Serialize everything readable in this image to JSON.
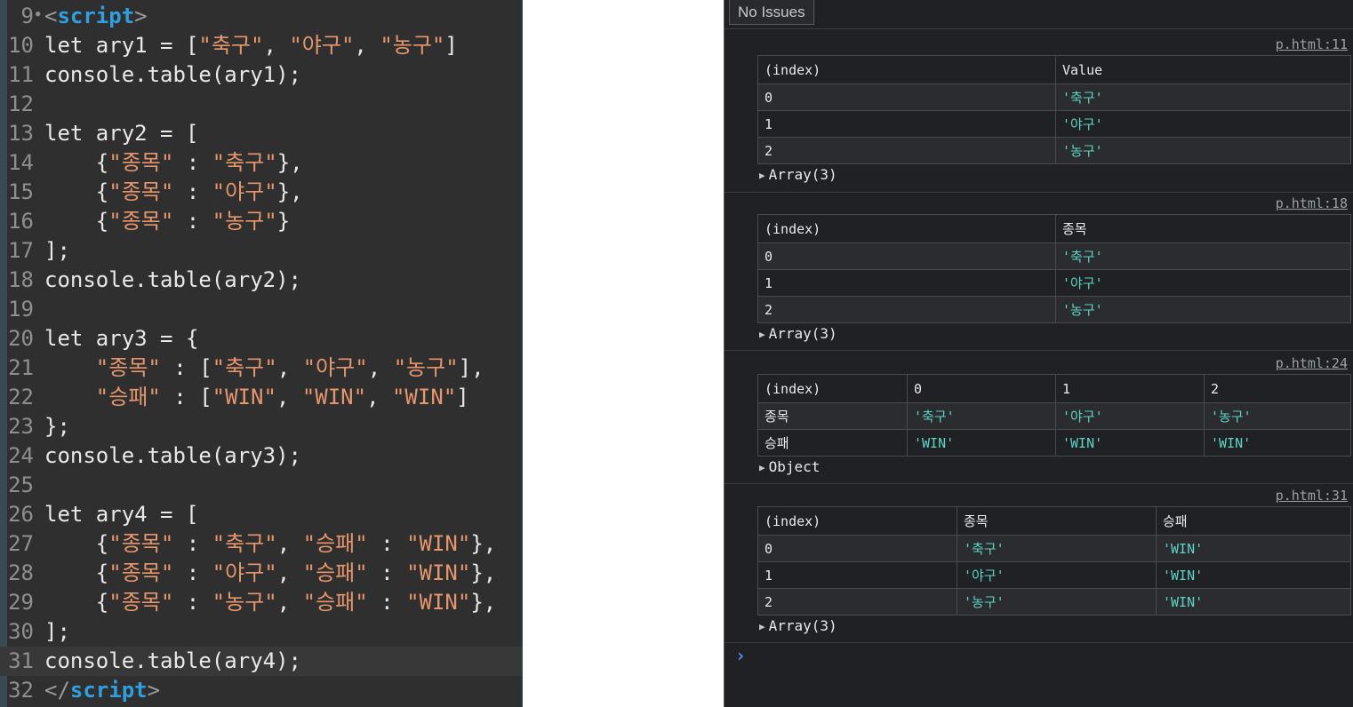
{
  "editor": {
    "lines": [
      {
        "num": "9",
        "fold": true,
        "tokens": [
          {
            "t": "<",
            "c": "tok-bracket"
          },
          {
            "t": "script",
            "c": "tok-tag"
          },
          {
            "t": ">",
            "c": "tok-bracket"
          }
        ]
      },
      {
        "num": "10",
        "tokens": [
          {
            "t": "let ary1 = [",
            "c": "tok-plain"
          },
          {
            "t": "\"축구\"",
            "c": "tok-str"
          },
          {
            "t": ", ",
            "c": "tok-plain"
          },
          {
            "t": "\"야구\"",
            "c": "tok-str"
          },
          {
            "t": ", ",
            "c": "tok-plain"
          },
          {
            "t": "\"농구\"",
            "c": "tok-str"
          },
          {
            "t": "]",
            "c": "tok-plain"
          }
        ]
      },
      {
        "num": "11",
        "tokens": [
          {
            "t": "console.table(ary1);",
            "c": "tok-plain"
          }
        ]
      },
      {
        "num": "12",
        "tokens": []
      },
      {
        "num": "13",
        "tokens": [
          {
            "t": "let ary2 = [",
            "c": "tok-plain"
          }
        ]
      },
      {
        "num": "14",
        "tokens": [
          {
            "t": "    {",
            "c": "tok-plain"
          },
          {
            "t": "\"종목\"",
            "c": "tok-str"
          },
          {
            "t": " : ",
            "c": "tok-plain"
          },
          {
            "t": "\"축구\"",
            "c": "tok-str"
          },
          {
            "t": "},",
            "c": "tok-plain"
          }
        ]
      },
      {
        "num": "15",
        "tokens": [
          {
            "t": "    {",
            "c": "tok-plain"
          },
          {
            "t": "\"종목\"",
            "c": "tok-str"
          },
          {
            "t": " : ",
            "c": "tok-plain"
          },
          {
            "t": "\"야구\"",
            "c": "tok-str"
          },
          {
            "t": "},",
            "c": "tok-plain"
          }
        ]
      },
      {
        "num": "16",
        "tokens": [
          {
            "t": "    {",
            "c": "tok-plain"
          },
          {
            "t": "\"종목\"",
            "c": "tok-str"
          },
          {
            "t": " : ",
            "c": "tok-plain"
          },
          {
            "t": "\"농구\"",
            "c": "tok-str"
          },
          {
            "t": "}",
            "c": "tok-plain"
          }
        ]
      },
      {
        "num": "17",
        "tokens": [
          {
            "t": "];",
            "c": "tok-plain"
          }
        ]
      },
      {
        "num": "18",
        "tokens": [
          {
            "t": "console.table(ary2);",
            "c": "tok-plain"
          }
        ]
      },
      {
        "num": "19",
        "tokens": []
      },
      {
        "num": "20",
        "tokens": [
          {
            "t": "let ary3 = {",
            "c": "tok-plain"
          }
        ]
      },
      {
        "num": "21",
        "tokens": [
          {
            "t": "    ",
            "c": "tok-plain"
          },
          {
            "t": "\"종목\"",
            "c": "tok-str"
          },
          {
            "t": " : [",
            "c": "tok-plain"
          },
          {
            "t": "\"축구\"",
            "c": "tok-str"
          },
          {
            "t": ", ",
            "c": "tok-plain"
          },
          {
            "t": "\"야구\"",
            "c": "tok-str"
          },
          {
            "t": ", ",
            "c": "tok-plain"
          },
          {
            "t": "\"농구\"",
            "c": "tok-str"
          },
          {
            "t": "],",
            "c": "tok-plain"
          }
        ]
      },
      {
        "num": "22",
        "tokens": [
          {
            "t": "    ",
            "c": "tok-plain"
          },
          {
            "t": "\"승패\"",
            "c": "tok-str"
          },
          {
            "t": " : [",
            "c": "tok-plain"
          },
          {
            "t": "\"WIN\"",
            "c": "tok-str"
          },
          {
            "t": ", ",
            "c": "tok-plain"
          },
          {
            "t": "\"WIN\"",
            "c": "tok-str"
          },
          {
            "t": ", ",
            "c": "tok-plain"
          },
          {
            "t": "\"WIN\"",
            "c": "tok-str"
          },
          {
            "t": "]",
            "c": "tok-plain"
          }
        ]
      },
      {
        "num": "23",
        "tokens": [
          {
            "t": "};",
            "c": "tok-plain"
          }
        ]
      },
      {
        "num": "24",
        "tokens": [
          {
            "t": "console.table(ary3);",
            "c": "tok-plain"
          }
        ]
      },
      {
        "num": "25",
        "tokens": []
      },
      {
        "num": "26",
        "tokens": [
          {
            "t": "let ary4 = [",
            "c": "tok-plain"
          }
        ]
      },
      {
        "num": "27",
        "tokens": [
          {
            "t": "    {",
            "c": "tok-plain"
          },
          {
            "t": "\"종목\"",
            "c": "tok-str"
          },
          {
            "t": " : ",
            "c": "tok-plain"
          },
          {
            "t": "\"축구\"",
            "c": "tok-str"
          },
          {
            "t": ", ",
            "c": "tok-plain"
          },
          {
            "t": "\"승패\"",
            "c": "tok-str"
          },
          {
            "t": " : ",
            "c": "tok-plain"
          },
          {
            "t": "\"WIN\"",
            "c": "tok-str"
          },
          {
            "t": "},",
            "c": "tok-plain"
          }
        ]
      },
      {
        "num": "28",
        "tokens": [
          {
            "t": "    {",
            "c": "tok-plain"
          },
          {
            "t": "\"종목\"",
            "c": "tok-str"
          },
          {
            "t": " : ",
            "c": "tok-plain"
          },
          {
            "t": "\"야구\"",
            "c": "tok-str"
          },
          {
            "t": ", ",
            "c": "tok-plain"
          },
          {
            "t": "\"승패\"",
            "c": "tok-str"
          },
          {
            "t": " : ",
            "c": "tok-plain"
          },
          {
            "t": "\"WIN\"",
            "c": "tok-str"
          },
          {
            "t": "},",
            "c": "tok-plain"
          }
        ]
      },
      {
        "num": "29",
        "tokens": [
          {
            "t": "    {",
            "c": "tok-plain"
          },
          {
            "t": "\"종목\"",
            "c": "tok-str"
          },
          {
            "t": " : ",
            "c": "tok-plain"
          },
          {
            "t": "\"농구\"",
            "c": "tok-str"
          },
          {
            "t": ", ",
            "c": "tok-plain"
          },
          {
            "t": "\"승패\"",
            "c": "tok-str"
          },
          {
            "t": " : ",
            "c": "tok-plain"
          },
          {
            "t": "\"WIN\"",
            "c": "tok-str"
          },
          {
            "t": "},",
            "c": "tok-plain"
          }
        ]
      },
      {
        "num": "30",
        "tokens": [
          {
            "t": "];",
            "c": "tok-plain"
          }
        ]
      },
      {
        "num": "31",
        "current": true,
        "tokens": [
          {
            "t": "console.table(ary4);",
            "c": "tok-plain"
          }
        ]
      },
      {
        "num": "32",
        "tokens": [
          {
            "t": "</",
            "c": "tok-bracket"
          },
          {
            "t": "script",
            "c": "tok-tag"
          },
          {
            "t": ">",
            "c": "tok-bracket"
          }
        ]
      }
    ]
  },
  "console": {
    "issues_label": "No Issues",
    "prompt_symbol": "›",
    "entries": [
      {
        "source": "p.html:11",
        "headers": [
          "(index)",
          "Value"
        ],
        "col_widths": [
          335,
          332
        ],
        "rows": [
          [
            "0",
            "'축구'"
          ],
          [
            "1",
            "'야구'"
          ],
          [
            "2",
            "'농구'"
          ]
        ],
        "summary": "Array(3)"
      },
      {
        "source": "p.html:18",
        "headers": [
          "(index)",
          "종목"
        ],
        "col_widths": [
          335,
          332
        ],
        "rows": [
          [
            "0",
            "'축구'"
          ],
          [
            "1",
            "'야구'"
          ],
          [
            "2",
            "'농구'"
          ]
        ],
        "summary": "Array(3)"
      },
      {
        "source": "p.html:24",
        "headers": [
          "(index)",
          "0",
          "1",
          "2"
        ],
        "col_widths": [
          168,
          167,
          167,
          165
        ],
        "rows": [
          [
            "종목",
            "'축구'",
            "'야구'",
            "'농구'"
          ],
          [
            "승패",
            "'WIN'",
            "'WIN'",
            "'WIN'"
          ]
        ],
        "summary": "Object"
      },
      {
        "source": "p.html:31",
        "headers": [
          "(index)",
          "종목",
          "승패"
        ],
        "col_widths": [
          224,
          224,
          219
        ],
        "rows": [
          [
            "0",
            "'축구'",
            "'WIN'"
          ],
          [
            "1",
            "'야구'",
            "'WIN'"
          ],
          [
            "2",
            "'농구'",
            "'WIN'"
          ]
        ],
        "summary": "Array(3)"
      }
    ]
  }
}
